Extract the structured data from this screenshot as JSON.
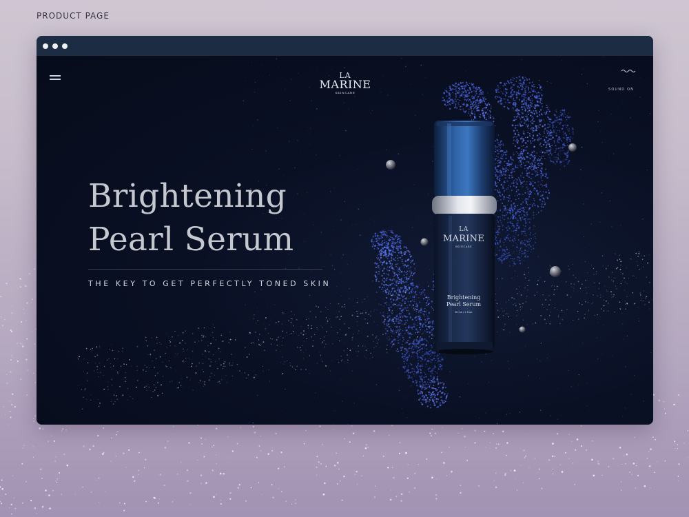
{
  "page_label": "PRODUCT PAGE",
  "window": {
    "controls": [
      "close-dot",
      "minimize-dot",
      "maximize-dot"
    ]
  },
  "header": {
    "menu_icon": "hamburger-menu-icon",
    "logo": {
      "line1": "LA",
      "line2": "MARINE",
      "line3": "SKINCARE"
    },
    "sound": {
      "icon": "sound-wave-icon",
      "label": "SOUND ON"
    }
  },
  "hero": {
    "title_line1": "Brightening",
    "title_line2": "Pearl Serum",
    "tagline": "THE KEY TO GET PERFECTLY TONED SKIN"
  },
  "product": {
    "brand_line1": "LA",
    "brand_line2": "MARINE",
    "brand_line3": "SKINCARE",
    "name_line1": "Brightening",
    "name_line2": "Pearl Serum",
    "volume": "30 mL / 1 fl.oz."
  },
  "colors": {
    "hero_background": "#0a1024",
    "titlebar": "#1c2c42",
    "particles": "#4a62d8",
    "headline": "#c6c8d0"
  }
}
